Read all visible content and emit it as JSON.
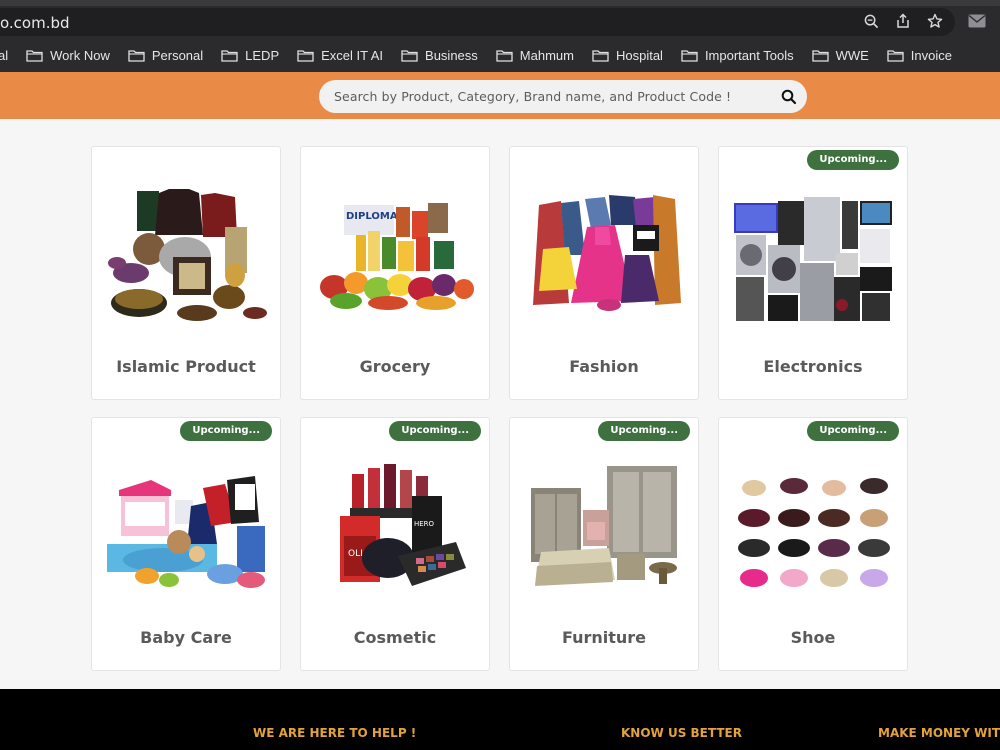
{
  "browser": {
    "url": "o.com.bd",
    "bookmarks": [
      "al",
      "Work Now",
      "Personal",
      "LEDP",
      "Excel IT AI",
      "Business",
      "Mahmum",
      "Hospital",
      "Important Tools",
      "WWE",
      "Invoice"
    ]
  },
  "header": {
    "search_placeholder": "Search by Product, Category, Brand name, and Product Code !"
  },
  "categories": [
    {
      "title": "Islamic Product",
      "badge": ""
    },
    {
      "title": "Grocery",
      "badge": ""
    },
    {
      "title": "Fashion",
      "badge": ""
    },
    {
      "title": "Electronics",
      "badge": "Upcoming..."
    },
    {
      "title": "Baby Care",
      "badge": "Upcoming..."
    },
    {
      "title": "Cosmetic",
      "badge": "Upcoming..."
    },
    {
      "title": "Furniture",
      "badge": "Upcoming..."
    },
    {
      "title": "Shoe",
      "badge": "Upcoming..."
    }
  ],
  "footer": {
    "help": "WE ARE HERE TO HELP !",
    "know": "KNOW US BETTER",
    "money": "MAKE MONEY WITH U"
  },
  "colors": {
    "orange": "#e98a47",
    "badge_green": "#3f7040",
    "footer_heading": "#e3a23c"
  }
}
